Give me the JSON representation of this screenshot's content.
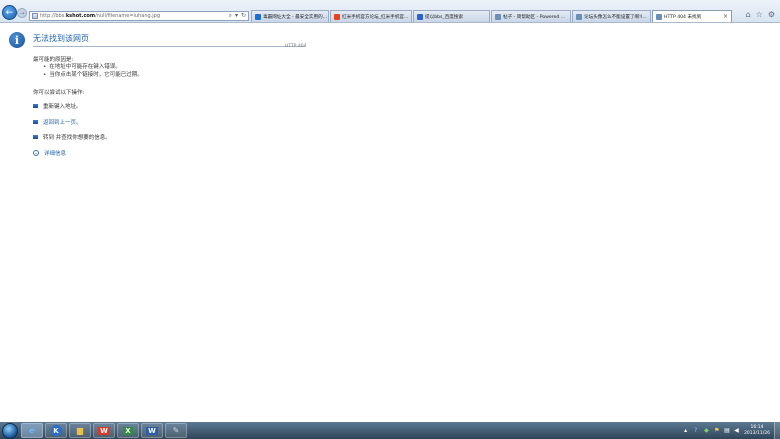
{
  "address_bar": {
    "url_plain_1": "http://bbs.",
    "url_host": "kshot.com",
    "url_plain_2": "/null/filename=luhang.jpg"
  },
  "tabs": [
    {
      "label": "毒霸网址大全 - 最安全实用的...",
      "color": "#1c6fd1"
    },
    {
      "label": "红米手机官方论坛_红米手机官...",
      "color": "#e8431e"
    },
    {
      "label": "提以bbs_百度搜索",
      "color": "#2b63c7"
    },
    {
      "label": "帖子 - 简帮助区 - Powered ...",
      "color": "#6b8fb8"
    },
    {
      "label": "论坛头像怎么不能设置了啊!I...",
      "color": "#6b8fb8"
    },
    {
      "label": "HTTP 404 未找到",
      "color": "#6b8fb8",
      "close": "×"
    }
  ],
  "page": {
    "title": "无法找到该网页",
    "http_code": "HTTP 404",
    "reasons_title": "最可能的原因是:",
    "reasons": [
      "在地址中可能存在键入错误。",
      "当你点击某个链接时，它可能已过期。"
    ],
    "actions_title": "你可以尝试以下操作:",
    "actions": [
      {
        "text": "重新键入地址。"
      },
      {
        "text": "返回到上一页。"
      },
      {
        "text": "转到  并查找你想要的信息。"
      }
    ],
    "details_label": "详细信息"
  },
  "taskbar": {
    "apps": [
      {
        "name": "ie-icon",
        "glyph": "e",
        "color": "#3d8ee0"
      },
      {
        "name": "kuaibo-icon",
        "glyph": "K",
        "color": "#2a6fc9"
      },
      {
        "name": "folder-icon",
        "glyph": "▆",
        "color": "#e7c14a"
      },
      {
        "name": "wps-writer-icon",
        "glyph": "W",
        "color": "#d23a2a"
      },
      {
        "name": "excel-icon",
        "glyph": "X",
        "color": "#2f8d3f"
      },
      {
        "name": "word-icon",
        "glyph": "W",
        "color": "#2d5ca8"
      },
      {
        "name": "paint-icon",
        "glyph": "✎",
        "color": "#9aa5b0"
      }
    ],
    "clock_time": "16:14",
    "clock_date": "2013/11/26"
  }
}
